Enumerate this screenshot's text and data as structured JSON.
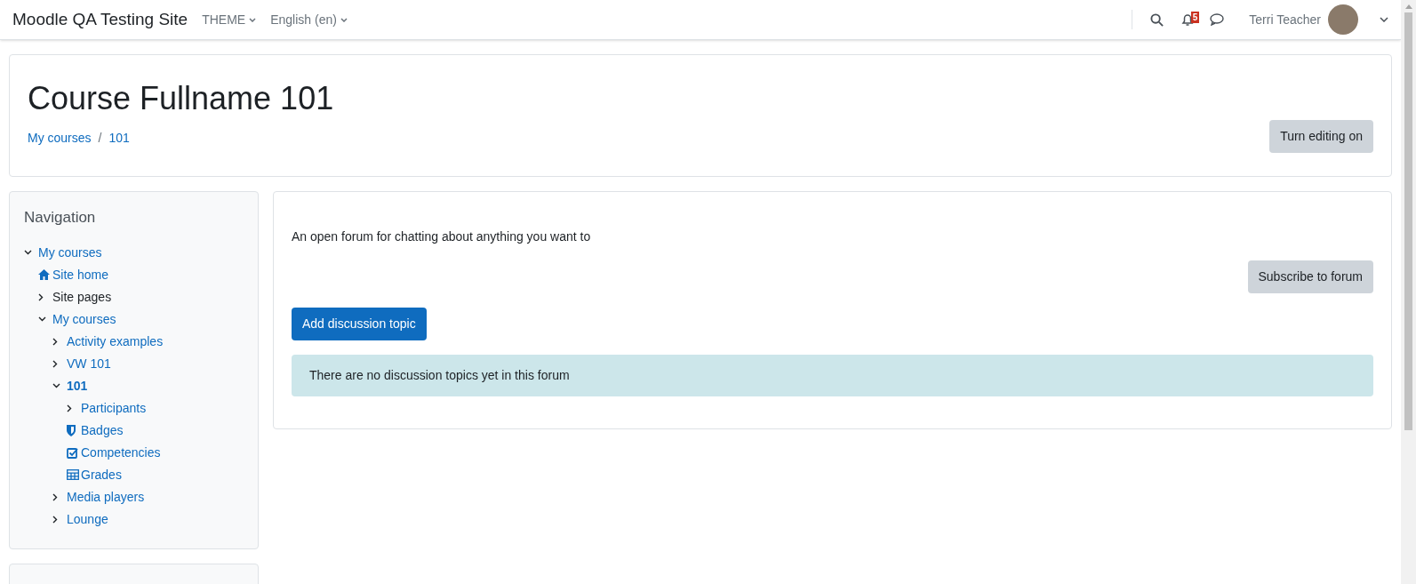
{
  "navbar": {
    "site_name": "Moodle QA Testing Site",
    "menus": [
      "THEME",
      "English (en)"
    ],
    "notification_count": "5",
    "user_name": "Terri Teacher"
  },
  "header": {
    "title": "Course Fullname 101",
    "breadcrumb": [
      "My courses",
      "/",
      "101"
    ],
    "button": "Turn editing on"
  },
  "navigation": {
    "title": "Navigation",
    "items": [
      {
        "label": "My courses",
        "kind": "branch",
        "expanded": true,
        "link": true,
        "selected": false,
        "children": [
          {
            "label": "Site home",
            "kind": "home",
            "link": true,
            "selected": false
          },
          {
            "label": "Site pages",
            "kind": "branch",
            "link": false,
            "selected": false
          },
          {
            "label": "My courses",
            "kind": "branch",
            "expanded": true,
            "link": true,
            "selected": false,
            "children": [
              {
                "label": "Activity examples",
                "kind": "branch",
                "link": true,
                "selected": false
              },
              {
                "label": "VW 101",
                "kind": "branch",
                "link": true,
                "selected": false
              },
              {
                "label": "101",
                "kind": "branch",
                "expanded": true,
                "link": true,
                "selected": true,
                "children": [
                  {
                    "label": "Participants",
                    "kind": "branch",
                    "link": true,
                    "selected": false
                  },
                  {
                    "label": "Badges",
                    "kind": "badge",
                    "link": true,
                    "selected": false
                  },
                  {
                    "label": "Competencies",
                    "kind": "check",
                    "link": true,
                    "selected": false
                  },
                  {
                    "label": "Grades",
                    "kind": "grid",
                    "link": true,
                    "selected": false
                  }
                ]
              },
              {
                "label": "Media players",
                "kind": "branch",
                "link": true,
                "selected": false
              },
              {
                "label": "Lounge",
                "kind": "branch",
                "link": true,
                "selected": false
              }
            ]
          }
        ]
      }
    ]
  },
  "forum": {
    "description": "An open forum for chatting about anything you want to",
    "subscribe_button": "Subscribe to forum",
    "add_button": "Add discussion topic",
    "notice": "There are no discussion topics yet in this forum"
  }
}
